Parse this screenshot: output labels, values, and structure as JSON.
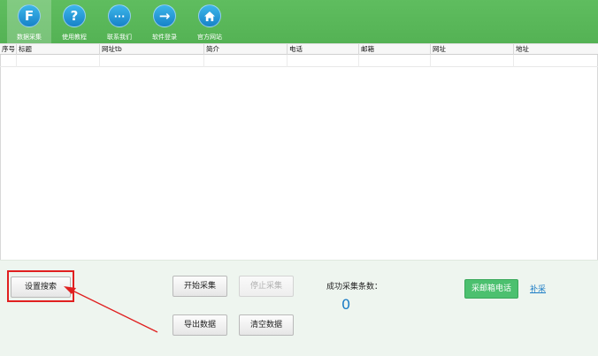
{
  "toolbar": {
    "items": [
      {
        "label": "数据采集",
        "icon": "f-letter-icon",
        "glyph": "F"
      },
      {
        "label": "使用教程",
        "icon": "help-icon",
        "glyph": "?"
      },
      {
        "label": "联系我们",
        "icon": "chat-bubble-icon",
        "glyph": "···"
      },
      {
        "label": "软件登录",
        "icon": "arrow-right-icon",
        "glyph": "→"
      },
      {
        "label": "官方网站",
        "icon": "home-icon",
        "glyph": "⌂"
      }
    ]
  },
  "table": {
    "columns": [
      "序号",
      "标题",
      "网址tb",
      "简介",
      "电话",
      "邮箱",
      "网址",
      "地址"
    ]
  },
  "panel": {
    "settings_search": "设置搜索",
    "start_collect": "开始采集",
    "stop_collect": "停止采集",
    "export_data": "导出数据",
    "clear_data": "清空数据",
    "success_count_label": "成功采集条数：",
    "success_count_value": "0",
    "collect_email_phone": "采邮箱电话",
    "supplement_link": "补采"
  },
  "colors": {
    "toolbar": "#5cb85c",
    "icon_blue": "#1782c8",
    "highlight": "#e02020",
    "accent_green": "#4cc06f",
    "link_blue": "#1a7bc5"
  }
}
